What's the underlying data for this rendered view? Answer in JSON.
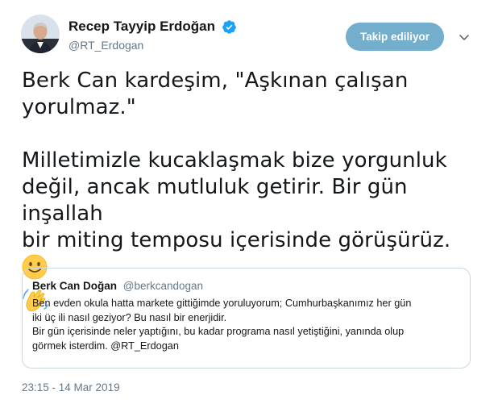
{
  "author": {
    "name": "Recep Tayyip Erdoğan",
    "handle": "@RT_Erdogan",
    "verified": true,
    "avatar_icon": "profile-photo"
  },
  "follow_button": {
    "label": "Takip ediliyor",
    "color": "#74aecd"
  },
  "menu_icon": "chevron-down-icon",
  "tweet": {
    "line1": "Berk Can kardeşim, \"Aşkınan çalışan",
    "line2": "yorulmaz.\"",
    "line3": "Milletimizle kucaklaşmak bize yorgunluk",
    "line4": "değil, ancak mutluluk getirir. Bir gün inşallah",
    "line5": "bir miting temposu içerisinde görüşürüz.",
    "emojis": [
      "slightly-smiling-face",
      "waving-hand"
    ]
  },
  "quoted_tweet": {
    "name": "Berk Can Doğan",
    "handle": "@berkcandogan",
    "lines": [
      "Ben evden okula hatta markete gittiğimde yoruluyorum; Cumhurbaşkanımız her gün",
      "iki üç ili nasıl geziyor? Bu nasıl bir enerjidir.",
      "Bir gün içerisinde neler yaptığını, bu kadar programa nasıl yetiştiğini, yanında olup",
      "görmek isterdim. @RT_Erdogan"
    ]
  },
  "timestamp": "23:15 - 14 Mar 2019",
  "colors": {
    "text": "#14171a",
    "secondary": "#657786",
    "verified_blue": "#1da1f2",
    "border": "#ccd6dd"
  }
}
